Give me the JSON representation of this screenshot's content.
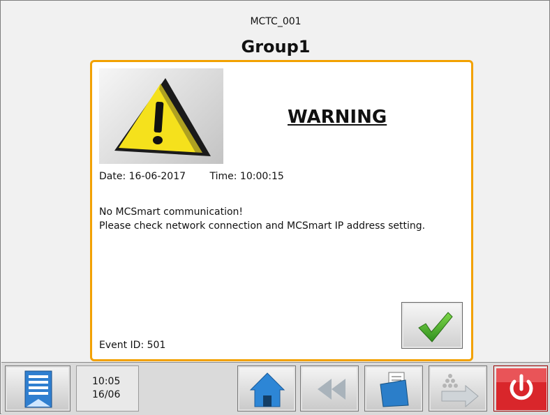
{
  "header": {
    "device_name": "MCTC_001",
    "group_title": "Group1"
  },
  "dialog": {
    "title": "WARNING",
    "date_label": "Date:",
    "date_value": "16-06-2017",
    "time_label": "Time:",
    "time_value": "10:00:15",
    "message_line1": "No MCSmart communication!",
    "message_line2": "Please check network connection and MCSmart IP address setting.",
    "event_label": "Event ID:",
    "event_value": "501",
    "confirm_icon": "checkmark-icon",
    "accent_color": "#f2a100"
  },
  "taskbar": {
    "menu_icon": "menu-list-icon",
    "clock_time": "10:05",
    "clock_date": "16/06",
    "home_icon": "home-icon",
    "back_icon": "rewind-icon",
    "notes_icon": "notes-icon",
    "export_icon": "export-arrow-icon",
    "power_icon": "power-icon",
    "power_color": "#d9262b"
  }
}
